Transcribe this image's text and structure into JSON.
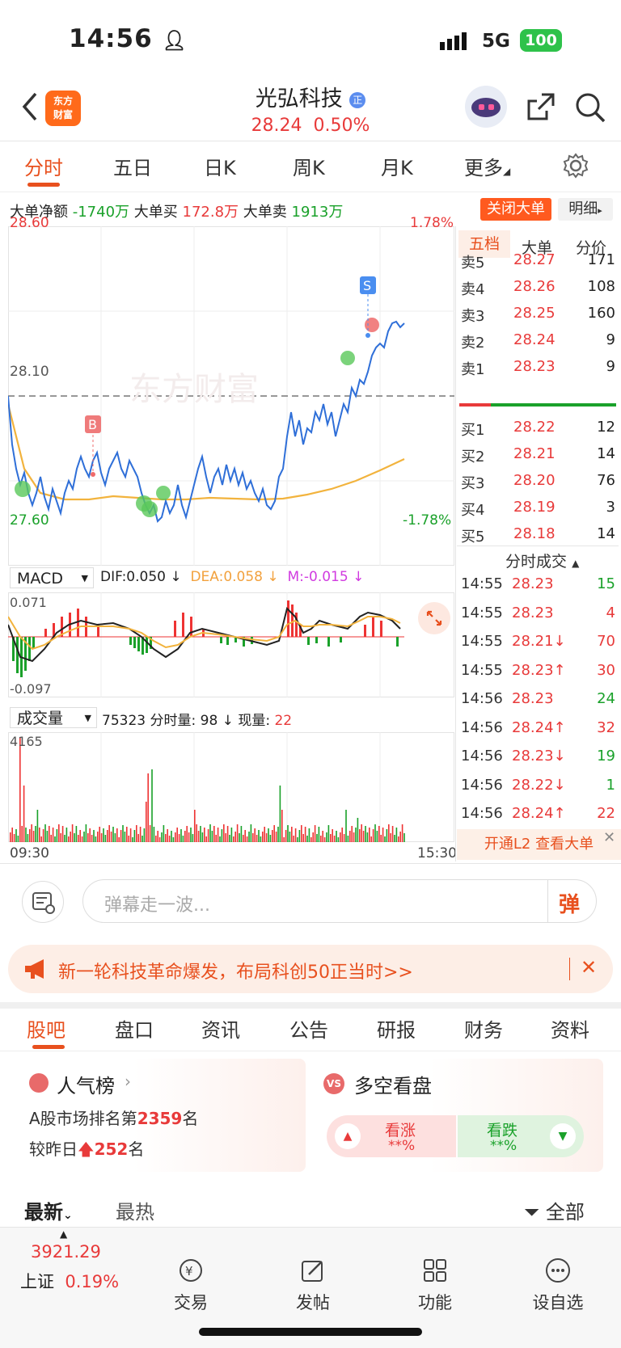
{
  "status": {
    "time": "14:56",
    "network": "5G",
    "battery": "100"
  },
  "header": {
    "stock_name": "光弘科技",
    "price": "28.24",
    "change": "0.50%",
    "logo_text_1": "东方",
    "logo_text_2": "财富",
    "badge": "正"
  },
  "tabs": [
    "分时",
    "五日",
    "日K",
    "周K",
    "月K",
    "更多"
  ],
  "big_orders": {
    "net_label": "大单净额",
    "net_value": "-1740万",
    "buy_label": "大单买",
    "buy_value": "172.8万",
    "sell_label": "大单卖",
    "sell_value": "1913万",
    "close_button": "关闭大单",
    "detail_button": "明细"
  },
  "intraday": {
    "high_price": "28.60",
    "low_price": "27.60",
    "mid_price": "28.10",
    "high_pct": "1.78%",
    "low_pct": "-1.78%",
    "start_time": "09:30",
    "end_time": "15:30",
    "watermark": "东方财富",
    "marker_b": "B",
    "marker_s": "S"
  },
  "macd": {
    "selector": "MACD",
    "dif": "DIF:0.050",
    "dea": "DEA:0.058",
    "m": "M:-0.015",
    "top": "0.071",
    "bottom": "-0.097"
  },
  "volume": {
    "selector": "成交量",
    "total": "75323",
    "minute_label": "分时量:",
    "minute_value": "98",
    "current_label": "现量:",
    "current_value": "22",
    "max": "4165"
  },
  "order_book": {
    "tabs": [
      "五档",
      "大单",
      "分价"
    ],
    "asks": [
      {
        "label": "卖5",
        "price": "28.27",
        "vol": "171"
      },
      {
        "label": "卖4",
        "price": "28.26",
        "vol": "108"
      },
      {
        "label": "卖3",
        "price": "28.25",
        "vol": "160"
      },
      {
        "label": "卖2",
        "price": "28.24",
        "vol": "9"
      },
      {
        "label": "卖1",
        "price": "28.23",
        "vol": "9"
      }
    ],
    "bids": [
      {
        "label": "买1",
        "price": "28.22",
        "vol": "12"
      },
      {
        "label": "买2",
        "price": "28.21",
        "vol": "14"
      },
      {
        "label": "买3",
        "price": "28.20",
        "vol": "76"
      },
      {
        "label": "买4",
        "price": "28.19",
        "vol": "3"
      },
      {
        "label": "买5",
        "price": "28.18",
        "vol": "14"
      }
    ]
  },
  "trades": {
    "title": "分时成交",
    "rows": [
      {
        "time": "14:55",
        "price": "28.23",
        "vol": "15"
      },
      {
        "time": "14:55",
        "price": "28.23",
        "vol": "4"
      },
      {
        "time": "14:55",
        "price": "28.21↓",
        "vol": "70"
      },
      {
        "time": "14:55",
        "price": "28.23↑",
        "vol": "30"
      },
      {
        "time": "14:56",
        "price": "28.23",
        "vol": "24"
      },
      {
        "time": "14:56",
        "price": "28.24↑",
        "vol": "32"
      },
      {
        "time": "14:56",
        "price": "28.23↓",
        "vol": "19"
      },
      {
        "time": "14:56",
        "price": "28.22↓",
        "vol": "1"
      },
      {
        "time": "14:56",
        "price": "28.24↑",
        "vol": "22"
      }
    ],
    "promo": "开通L2 查看大单"
  },
  "danmu": {
    "placeholder": "弹幕走一波...",
    "button": "弹"
  },
  "banner": {
    "text": "新一轮科技革命爆发，布局科创50正当时>>"
  },
  "section_tabs": [
    "股吧",
    "盘口",
    "资讯",
    "公告",
    "研报",
    "财务",
    "资料"
  ],
  "popularity": {
    "title": "人气榜",
    "rank_prefix": "A股市场排名第",
    "rank": "2359",
    "rank_suffix": "名",
    "change_prefix": "较昨日",
    "change": "252",
    "change_suffix": "名"
  },
  "sentiment": {
    "title": "多空看盘",
    "bull": "看涨",
    "bear": "看跌",
    "bull_pct": "**%",
    "bear_pct": "**%"
  },
  "feed": {
    "latest": "最新",
    "hot": "最热",
    "filter": "全部"
  },
  "bottom_nav": {
    "index_value": "3921.29",
    "index_name": "上证",
    "index_pct": "0.19%",
    "items": [
      "交易",
      "发帖",
      "功能",
      "设自选"
    ]
  }
}
